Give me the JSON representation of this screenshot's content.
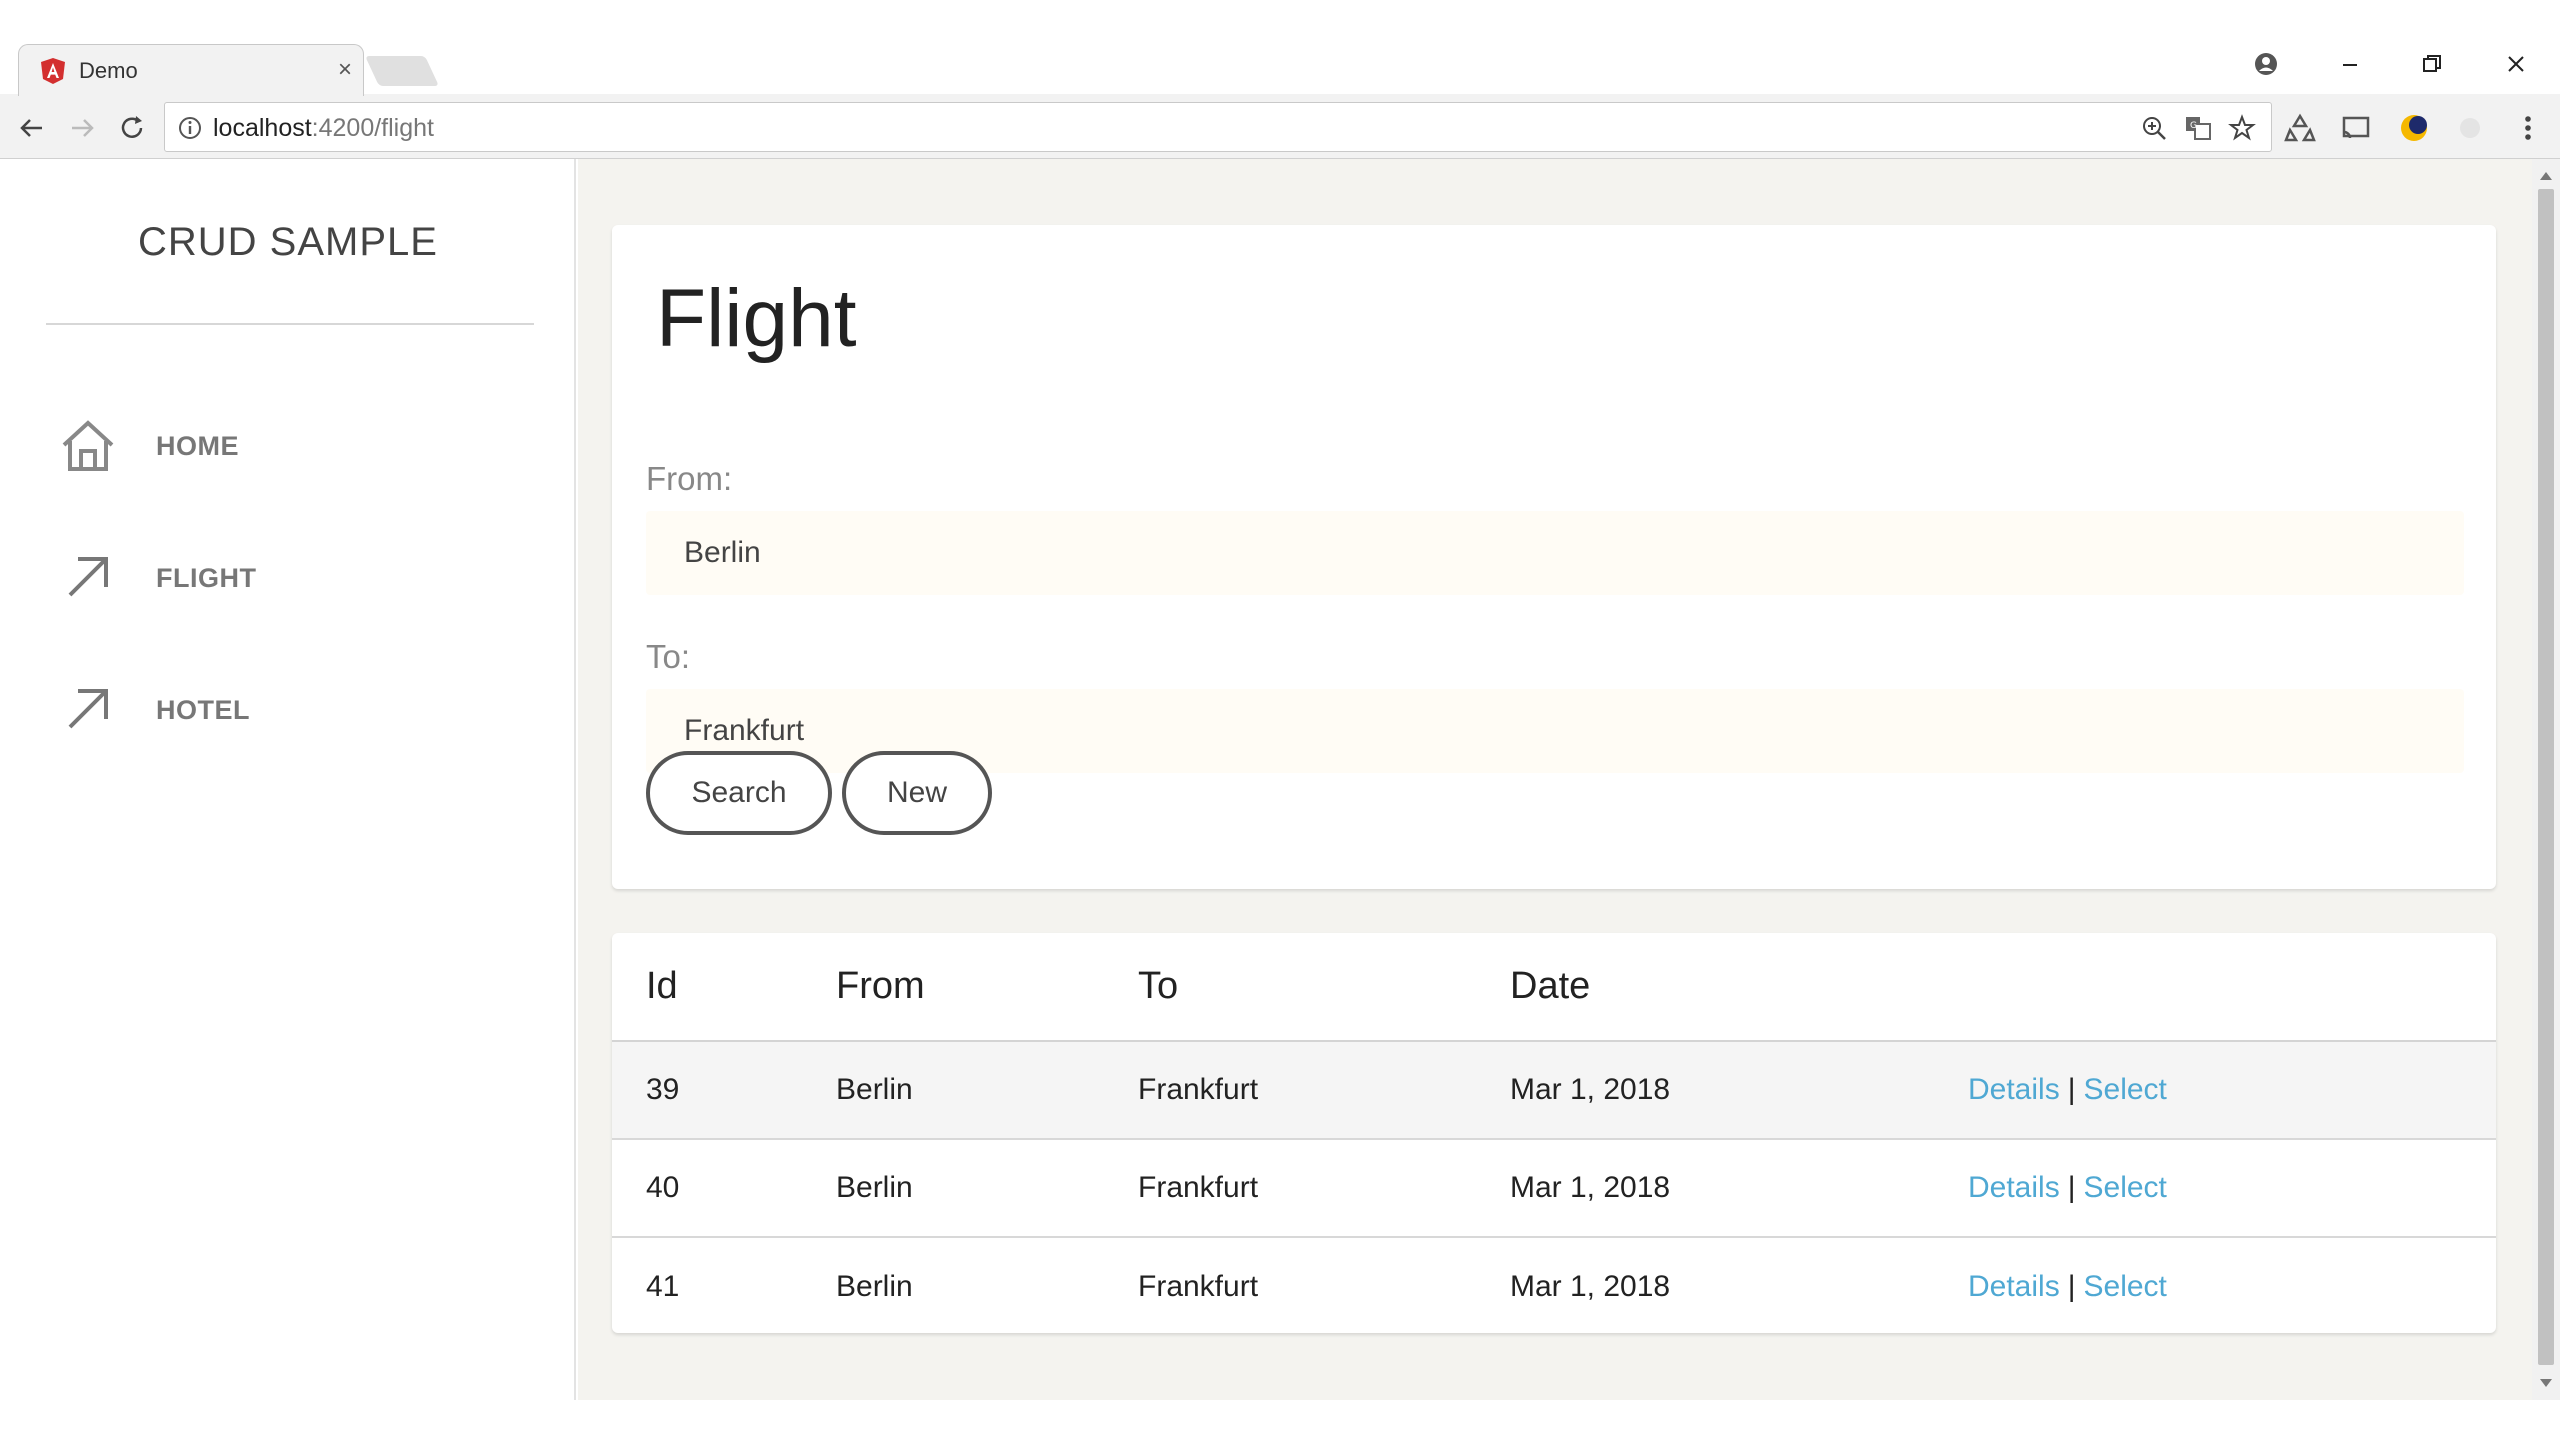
{
  "browser": {
    "tab_title": "Demo",
    "tab_close": "×",
    "url_host": "localhost",
    "url_path": ":4200/flight"
  },
  "sidebar": {
    "brand": "CRUD SAMPLE",
    "items": [
      {
        "label": "HOME",
        "icon": "home-icon"
      },
      {
        "label": "FLIGHT",
        "icon": "arrow-up-right-icon"
      },
      {
        "label": "HOTEL",
        "icon": "arrow-up-right-icon"
      }
    ]
  },
  "main": {
    "title": "Flight",
    "form": {
      "from_label": "From:",
      "from_value": "Berlin",
      "to_label": "To:",
      "to_value": "Frankfurt",
      "search_button": "Search",
      "new_button": "New"
    },
    "table": {
      "headers": [
        "Id",
        "From",
        "To",
        "Date"
      ],
      "rows": [
        {
          "id": "39",
          "from": "Berlin",
          "to": "Frankfurt",
          "date": "Mar 1, 2018",
          "details": "Details",
          "select": "Select"
        },
        {
          "id": "40",
          "from": "Berlin",
          "to": "Frankfurt",
          "date": "Mar 1, 2018",
          "details": "Details",
          "select": "Select"
        },
        {
          "id": "41",
          "from": "Berlin",
          "to": "Frankfurt",
          "date": "Mar 1, 2018",
          "details": "Details",
          "select": "Select"
        }
      ],
      "separator": "|"
    }
  },
  "colors": {
    "link": "#4fa8d3",
    "input_bg": "#fffcf5",
    "main_bg": "#f4f3ef"
  }
}
